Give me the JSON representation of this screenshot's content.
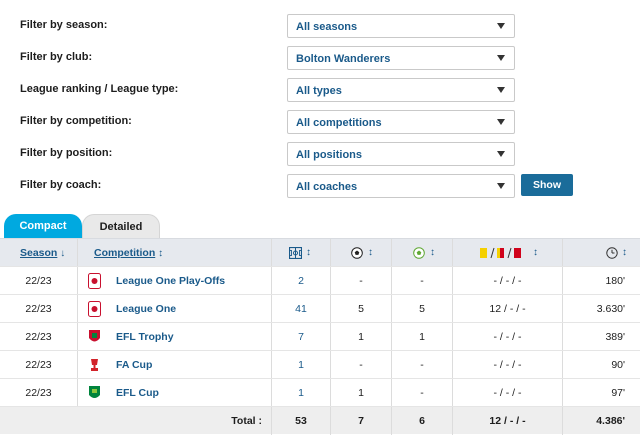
{
  "filters": [
    {
      "label": "Filter by season:",
      "value": "All seasons"
    },
    {
      "label": "Filter by club:",
      "value": "Bolton Wanderers"
    },
    {
      "label": "League ranking / League type:",
      "value": "All types"
    },
    {
      "label": "Filter by competition:",
      "value": "All competitions"
    },
    {
      "label": "Filter by position:",
      "value": "All positions"
    },
    {
      "label": "Filter by coach:",
      "value": "All coaches"
    }
  ],
  "show_label": "Show",
  "tabs": {
    "compact": "Compact",
    "detailed": "Detailed"
  },
  "table": {
    "headers": {
      "season": "Season",
      "competition": "Competition",
      "sort_down": "↓",
      "sort_both": "↕"
    },
    "rows": [
      {
        "season": "22/23",
        "competition": "League One Play-Offs",
        "apps": "2",
        "goals": "-",
        "assists": "-",
        "cards": "- / - / -",
        "minutes": "180'",
        "icon_color": "#c8102e"
      },
      {
        "season": "22/23",
        "competition": "League One",
        "apps": "41",
        "goals": "5",
        "assists": "5",
        "cards": "12 / - / -",
        "minutes": "3.630'",
        "icon_color": "#c8102e"
      },
      {
        "season": "22/23",
        "competition": "EFL Trophy",
        "apps": "7",
        "goals": "1",
        "assists": "1",
        "cards": "- / - / -",
        "minutes": "389'",
        "icon_color": "#c8102e"
      },
      {
        "season": "22/23",
        "competition": "FA Cup",
        "apps": "1",
        "goals": "-",
        "assists": "-",
        "cards": "- / - / -",
        "minutes": "90'",
        "icon_color": "#d2232a"
      },
      {
        "season": "22/23",
        "competition": "EFL Cup",
        "apps": "1",
        "goals": "1",
        "assists": "-",
        "cards": "- / - / -",
        "minutes": "97'",
        "icon_color": "#00843d"
      }
    ],
    "total": {
      "label": "Total :",
      "apps": "53",
      "goals": "7",
      "assists": "6",
      "cards": "12 / - / -",
      "minutes": "4.386'"
    }
  }
}
